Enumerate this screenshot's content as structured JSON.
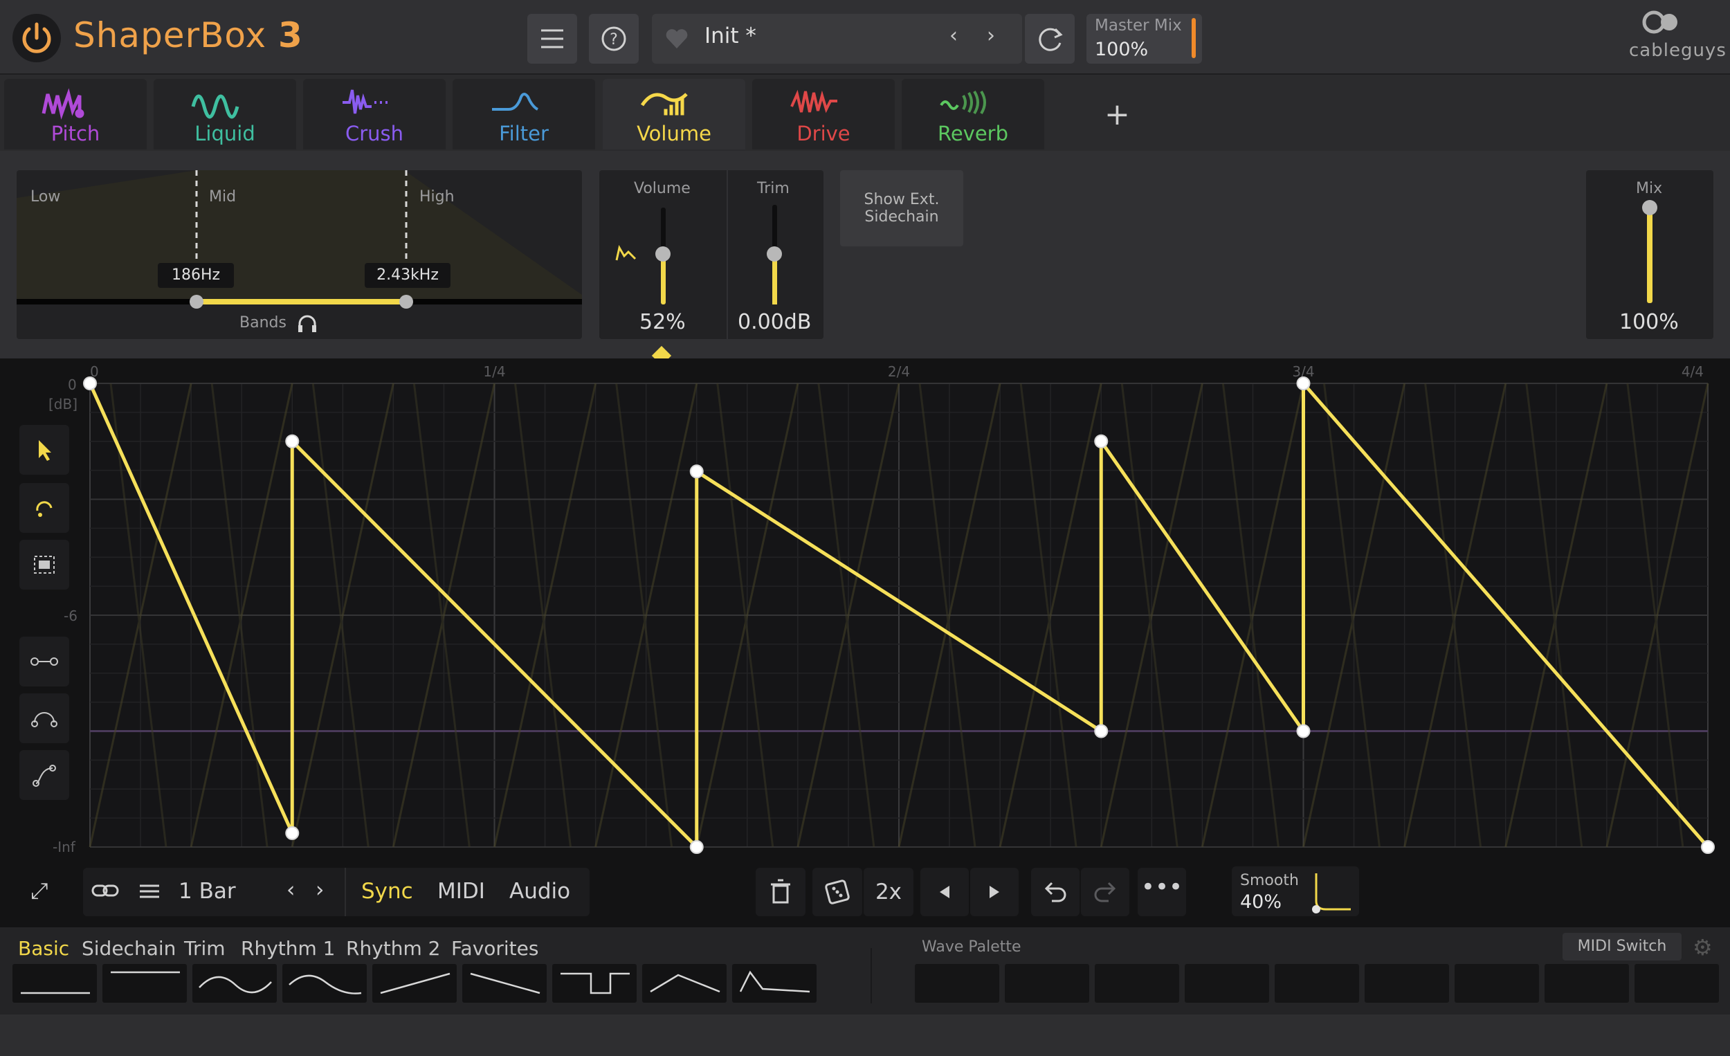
{
  "header": {
    "logo_main": "ShaperBox",
    "logo_version": "3",
    "preset_name": "Init *",
    "master_mix_label": "Master Mix",
    "master_mix_value": "100%",
    "brand": "cableguys",
    "accent_color": "#f0a24a"
  },
  "tabs": [
    {
      "label": "Pitch",
      "color": "#b04ad8",
      "icon": "pitch-wave-icon"
    },
    {
      "label": "Liquid",
      "color": "#3fbfa0",
      "icon": "liquid-wave-icon"
    },
    {
      "label": "Crush",
      "color": "#8a5cf0",
      "icon": "crush-wave-icon"
    },
    {
      "label": "Filter",
      "color": "#4a9ad8",
      "icon": "filter-curve-icon"
    },
    {
      "label": "Volume",
      "color": "#f6d84a",
      "icon": "volume-bars-icon"
    },
    {
      "label": "Drive",
      "color": "#e04848",
      "icon": "drive-wave-icon"
    },
    {
      "label": "Reverb",
      "color": "#5cc860",
      "icon": "reverb-wave-icon"
    }
  ],
  "bands": {
    "low_label": "Low",
    "mid_label": "Mid",
    "high_label": "High",
    "split1": "186Hz",
    "split2": "2.43kHz",
    "footer_label": "Bands"
  },
  "volume": {
    "label": "Volume",
    "value": "52%",
    "level": 0.52
  },
  "trim": {
    "label": "Trim",
    "value": "0.00dB"
  },
  "sidechain_btn": {
    "line1": "Show Ext.",
    "line2": "Sidechain"
  },
  "mix": {
    "label": "Mix",
    "value": "100%",
    "level": 1.0
  },
  "editor": {
    "x_ticks": [
      "0",
      "1/4",
      "2/4",
      "3/4",
      "4/4"
    ],
    "y_ticks": [
      "0",
      "[dB]",
      "-6",
      "-Inf"
    ],
    "line_color": "#f6e05a",
    "points": [
      [
        0.0,
        1.0
      ],
      [
        0.125,
        0.03
      ],
      [
        0.125,
        0.875
      ],
      [
        0.375,
        0.0
      ],
      [
        0.375,
        0.81
      ],
      [
        0.625,
        0.25
      ],
      [
        0.625,
        0.875
      ],
      [
        0.75,
        0.25
      ],
      [
        0.75,
        1.0
      ],
      [
        1.0,
        0.0
      ]
    ]
  },
  "toolbar": {
    "length": "1 Bar",
    "sync": "Sync",
    "midi": "MIDI",
    "audio": "Audio",
    "multiplier": "2x",
    "smooth_label": "Smooth",
    "smooth_value": "40%"
  },
  "palette": {
    "categories": [
      "Basic",
      "Sidechain",
      "Trim",
      "Rhythm 1",
      "Rhythm 2",
      "Favorites"
    ],
    "wave_palette_label": "Wave Palette",
    "midi_switch": "MIDI Switch"
  }
}
